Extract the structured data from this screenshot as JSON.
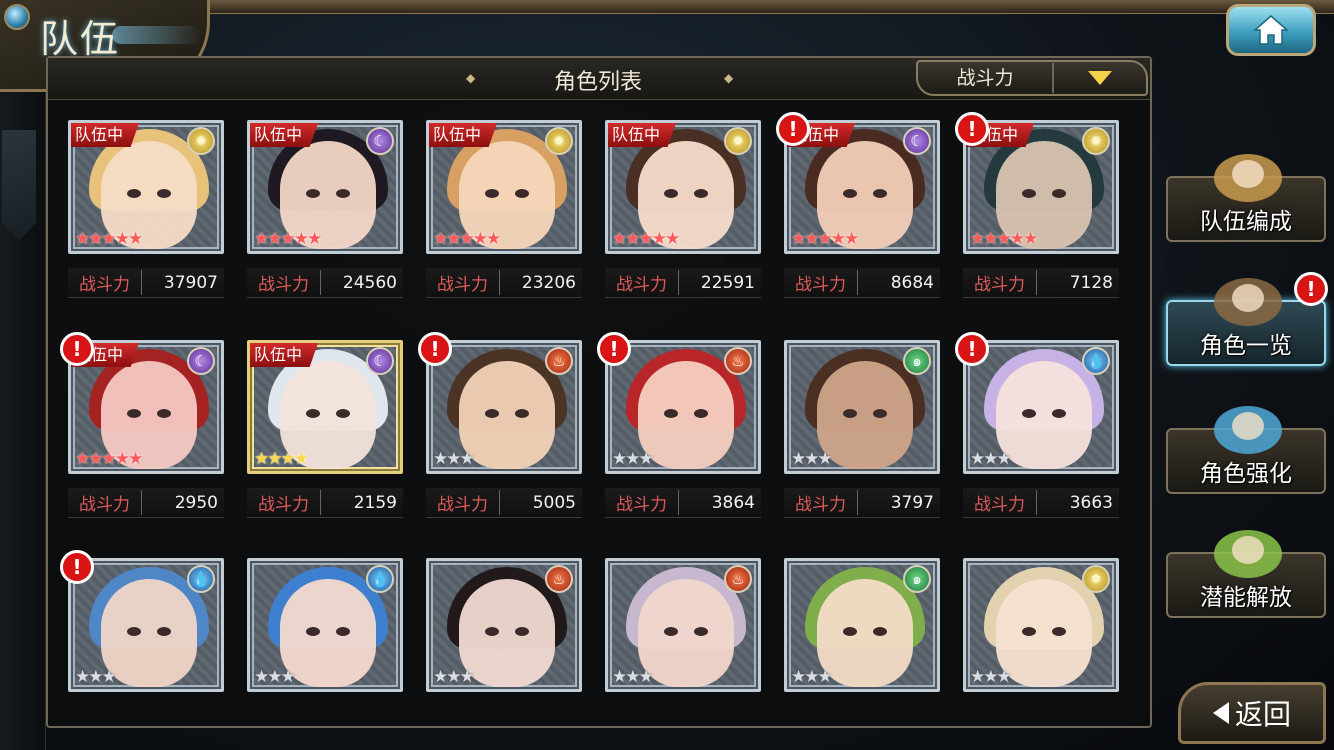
{
  "header": {
    "title": "队伍",
    "home_icon": "home-icon"
  },
  "panel": {
    "title": "角色列表",
    "sort_label": "战斗力"
  },
  "power_label": "战斗力",
  "team_badge_text": "队伍中",
  "alert_text": "!",
  "colors": {
    "power_label": "#e05a5a",
    "alert": "#d81414",
    "team_badge": "#d22a2a",
    "accent": "#5fc4ea"
  },
  "cards": [
    {
      "element": "sun",
      "in_team": true,
      "alert": false,
      "stars": 5,
      "star_color": "red",
      "power": "37907",
      "frame": "silver",
      "hair": "#e8c27a",
      "skin": "#f6dcc6"
    },
    {
      "element": "moon",
      "in_team": true,
      "alert": false,
      "stars": 5,
      "star_color": "red",
      "power": "24560",
      "frame": "silver",
      "hair": "#1f1a22",
      "skin": "#f3d7c8"
    },
    {
      "element": "sun",
      "in_team": true,
      "alert": false,
      "stars": 5,
      "star_color": "red",
      "power": "23206",
      "frame": "silver",
      "hair": "#d9a063",
      "skin": "#f6d6bb"
    },
    {
      "element": "sun",
      "in_team": true,
      "alert": false,
      "stars": 5,
      "star_color": "red",
      "power": "22591",
      "frame": "silver",
      "hair": "#4a2f25",
      "skin": "#f7dccb"
    },
    {
      "element": "moon",
      "in_team": true,
      "alert": true,
      "stars": 5,
      "star_color": "red",
      "power": "8684",
      "frame": "silver",
      "hair": "#4a2b22",
      "skin": "#f2cdb8"
    },
    {
      "element": "sun",
      "in_team": true,
      "alert": true,
      "stars": 5,
      "star_color": "red",
      "power": "7128",
      "frame": "silver",
      "hair": "#243a3e",
      "skin": "#d9c3b0"
    },
    {
      "element": "moon",
      "in_team": true,
      "alert": true,
      "stars": 5,
      "star_color": "red",
      "power": "2950",
      "frame": "silver",
      "hair": "#a52222",
      "skin": "#f6c9c3"
    },
    {
      "element": "moon",
      "in_team": true,
      "alert": false,
      "stars": 4,
      "star_color": "gold",
      "power": "2159",
      "frame": "gold",
      "hair": "#dfe6ee",
      "skin": "#f2e3da"
    },
    {
      "element": "fire",
      "in_team": false,
      "alert": true,
      "stars": 3,
      "star_color": "silver",
      "power": "5005",
      "frame": "silver",
      "hair": "#4b3426",
      "skin": "#f1d2b6"
    },
    {
      "element": "fire",
      "in_team": false,
      "alert": true,
      "stars": 3,
      "star_color": "silver",
      "power": "3864",
      "frame": "silver",
      "hair": "#b8262a",
      "skin": "#f4cfc0"
    },
    {
      "element": "wind",
      "in_team": false,
      "alert": false,
      "stars": 3,
      "star_color": "silver",
      "power": "3797",
      "frame": "silver",
      "hair": "#4a2f22",
      "skin": "#cfa58a"
    },
    {
      "element": "water",
      "in_team": false,
      "alert": true,
      "stars": 3,
      "star_color": "silver",
      "power": "3663",
      "frame": "silver",
      "hair": "#c7b2e6",
      "skin": "#f6e2dc"
    },
    {
      "element": "water",
      "in_team": false,
      "alert": true,
      "stars": 3,
      "star_color": "silver",
      "power": "",
      "frame": "silver",
      "hair": "#4f86c6",
      "skin": "#f0d5c6"
    },
    {
      "element": "water",
      "in_team": false,
      "alert": false,
      "stars": 3,
      "star_color": "silver",
      "power": "",
      "frame": "silver",
      "hair": "#3f7fcf",
      "skin": "#f5d9cf"
    },
    {
      "element": "fire",
      "in_team": false,
      "alert": false,
      "stars": 3,
      "star_color": "silver",
      "power": "",
      "frame": "silver",
      "hair": "#221a1a",
      "skin": "#f1dad2"
    },
    {
      "element": "fire",
      "in_team": false,
      "alert": false,
      "stars": 3,
      "star_color": "silver",
      "power": "",
      "frame": "silver",
      "hair": "#c7b7cf",
      "skin": "#f2d6cc"
    },
    {
      "element": "wind",
      "in_team": false,
      "alert": false,
      "stars": 3,
      "star_color": "silver",
      "power": "",
      "frame": "silver",
      "hair": "#7fae4a",
      "skin": "#f3dcc6"
    },
    {
      "element": "sun",
      "in_team": false,
      "alert": false,
      "stars": 3,
      "star_color": "silver",
      "power": "",
      "frame": "silver",
      "hair": "#e3d2b0",
      "skin": "#f5e1d2"
    }
  ],
  "side_menu": [
    {
      "label": "队伍编成",
      "icon": "team-members-icon",
      "active": false,
      "alert": false
    },
    {
      "label": "角色一览",
      "icon": "book-icon",
      "active": true,
      "alert": true
    },
    {
      "label": "角色强化",
      "icon": "crystal-upgrade-icon",
      "active": false,
      "alert": false
    },
    {
      "label": "潜能解放",
      "icon": "potential-orb-icon",
      "active": false,
      "alert": false
    }
  ],
  "back_label": "返回"
}
